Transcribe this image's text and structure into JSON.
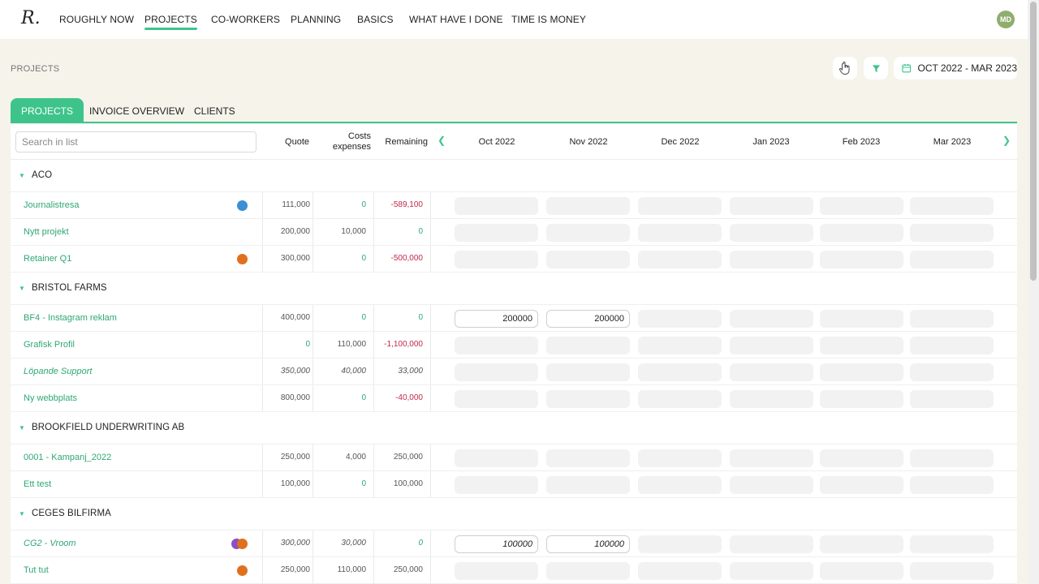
{
  "nav": {
    "logo": "R.",
    "items": [
      "ROUGHLY NOW",
      "PROJECTS",
      "CO-WORKERS",
      "PLANNING",
      "BASICS",
      "WHAT HAVE I DONE",
      "TIME IS MONEY"
    ],
    "active_index": 1,
    "avatar_initials": "MD"
  },
  "page": {
    "title": "PROJECTS",
    "date_range": "OCT 2022 - MAR 2023"
  },
  "tabs": [
    "PROJECTS",
    "INVOICE OVERVIEW",
    "CLIENTS"
  ],
  "table": {
    "search_placeholder": "Search in list",
    "columns": {
      "quote": "Quote",
      "costs_line1": "Costs",
      "costs_line2": "expenses",
      "remaining": "Remaining"
    },
    "months": [
      "Oct 2022",
      "Nov 2022",
      "Dec 2022",
      "Jan 2023",
      "Feb 2023",
      "Mar 2023"
    ],
    "groups": [
      {
        "name": "ACO",
        "projects": [
          {
            "name": "Journalistresa",
            "quote": "111,000",
            "costs": "0",
            "remaining": "-589,100",
            "italic": false,
            "dots": [
              "#3b8fd4"
            ],
            "months": [
              "",
              ""
            ]
          },
          {
            "name": "Nytt projekt",
            "quote": "200,000",
            "costs": "10,000",
            "remaining": "0",
            "italic": false,
            "dots": [],
            "months": [
              "",
              ""
            ]
          },
          {
            "name": "Retainer Q1",
            "quote": "300,000",
            "costs": "0",
            "remaining": "-500,000",
            "italic": false,
            "dots": [
              "#e0701e"
            ],
            "months": [
              "",
              ""
            ]
          }
        ]
      },
      {
        "name": "BRISTOL FARMS",
        "projects": [
          {
            "name": "BF4 - Instagram reklam",
            "quote": "400,000",
            "costs": "0",
            "remaining": "0",
            "italic": false,
            "dots": [],
            "months": [
              "200000",
              "200000"
            ]
          },
          {
            "name": "Grafisk Profil",
            "quote": "0",
            "costs": "110,000",
            "remaining": "-1,100,000",
            "italic": false,
            "dots": [],
            "months": [
              "",
              ""
            ]
          },
          {
            "name": "Löpande Support",
            "quote": "350,000",
            "costs": "40,000",
            "remaining": "33,000",
            "italic": true,
            "dots": [],
            "months": [
              "",
              ""
            ]
          },
          {
            "name": "Ny webbplats",
            "quote": "800,000",
            "costs": "0",
            "remaining": "-40,000",
            "italic": false,
            "dots": [],
            "months": [
              "",
              ""
            ]
          }
        ]
      },
      {
        "name": "BROOKFIELD UNDERWRITING AB",
        "projects": [
          {
            "name": "0001 - Kampanj_2022",
            "quote": "250,000",
            "costs": "4,000",
            "remaining": "250,000",
            "italic": false,
            "dots": [],
            "months": [
              "",
              ""
            ]
          },
          {
            "name": "Ett test",
            "quote": "100,000",
            "costs": "0",
            "remaining": "100,000",
            "italic": false,
            "dots": [],
            "months": [
              "",
              ""
            ]
          }
        ]
      },
      {
        "name": "CEGES BILFIRMA",
        "projects": [
          {
            "name": "CG2 - Vroom",
            "quote": "300,000",
            "costs": "30,000",
            "remaining": "0",
            "italic": true,
            "dots": [
              "#8a4fc9",
              "#e0701e"
            ],
            "months": [
              "100000",
              "100000"
            ]
          },
          {
            "name": "Tut tut",
            "quote": "250,000",
            "costs": "110,000",
            "remaining": "250,000",
            "italic": false,
            "dots": [
              "#e0701e"
            ],
            "months": [
              "",
              ""
            ]
          }
        ]
      }
    ]
  },
  "colors": {
    "accent": "#3ec48b",
    "negative": "#c0284a"
  }
}
